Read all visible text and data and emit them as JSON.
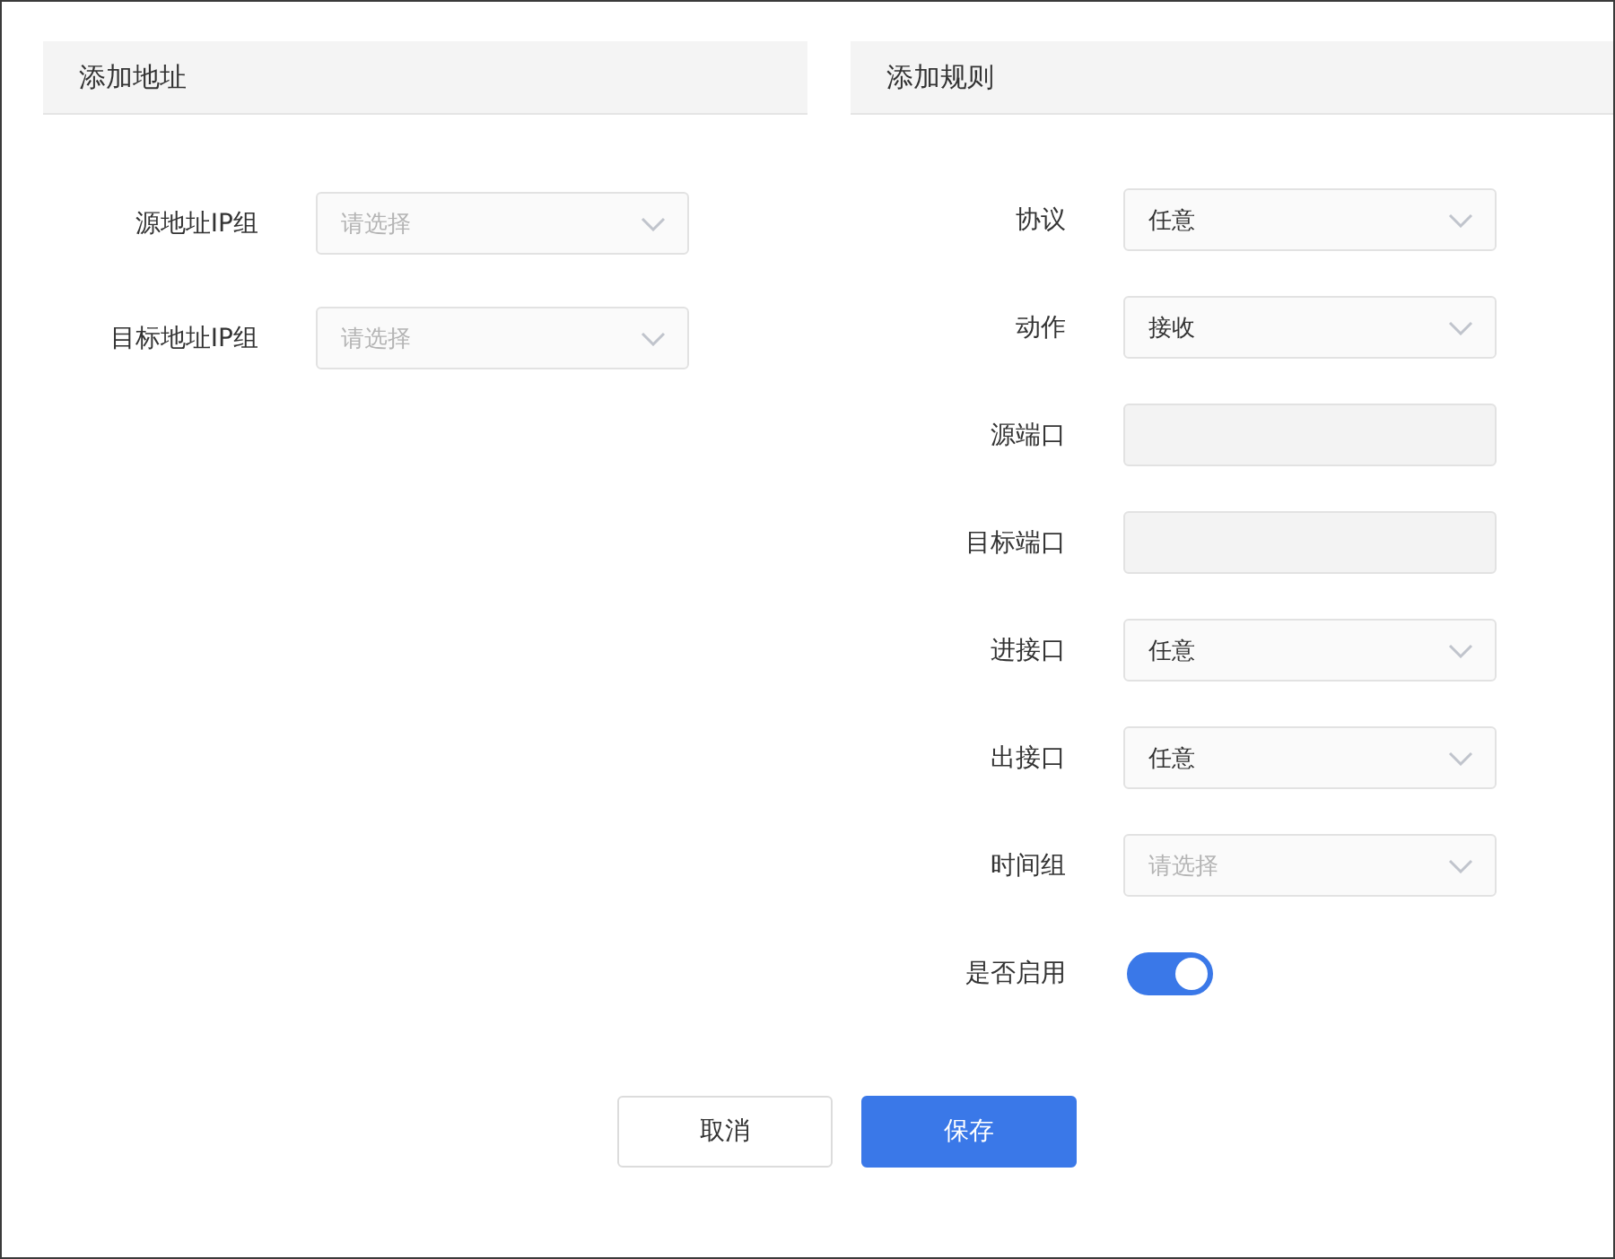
{
  "address_panel": {
    "title": "添加地址",
    "fields": [
      {
        "label": "源地址IP组",
        "kind": "select",
        "placeholder": "请选择"
      },
      {
        "label": "目标地址IP组",
        "kind": "select",
        "placeholder": "请选择"
      }
    ]
  },
  "rule_panel": {
    "title": "添加规则",
    "fields": [
      {
        "label": "协议",
        "kind": "select",
        "value": "任意"
      },
      {
        "label": "动作",
        "kind": "select",
        "value": "接收"
      },
      {
        "label": "源端口",
        "kind": "input",
        "disabled": true
      },
      {
        "label": "目标端口",
        "kind": "input",
        "disabled": true
      },
      {
        "label": "进接口",
        "kind": "select",
        "value": "任意"
      },
      {
        "label": "出接口",
        "kind": "select",
        "value": "任意"
      },
      {
        "label": "时间组",
        "kind": "select",
        "placeholder": "请选择"
      },
      {
        "label": "是否启用",
        "kind": "toggle",
        "on": true
      }
    ]
  },
  "buttons": [
    {
      "label": "取消",
      "kind": "secondary"
    },
    {
      "label": "保存",
      "kind": "primary"
    }
  ]
}
